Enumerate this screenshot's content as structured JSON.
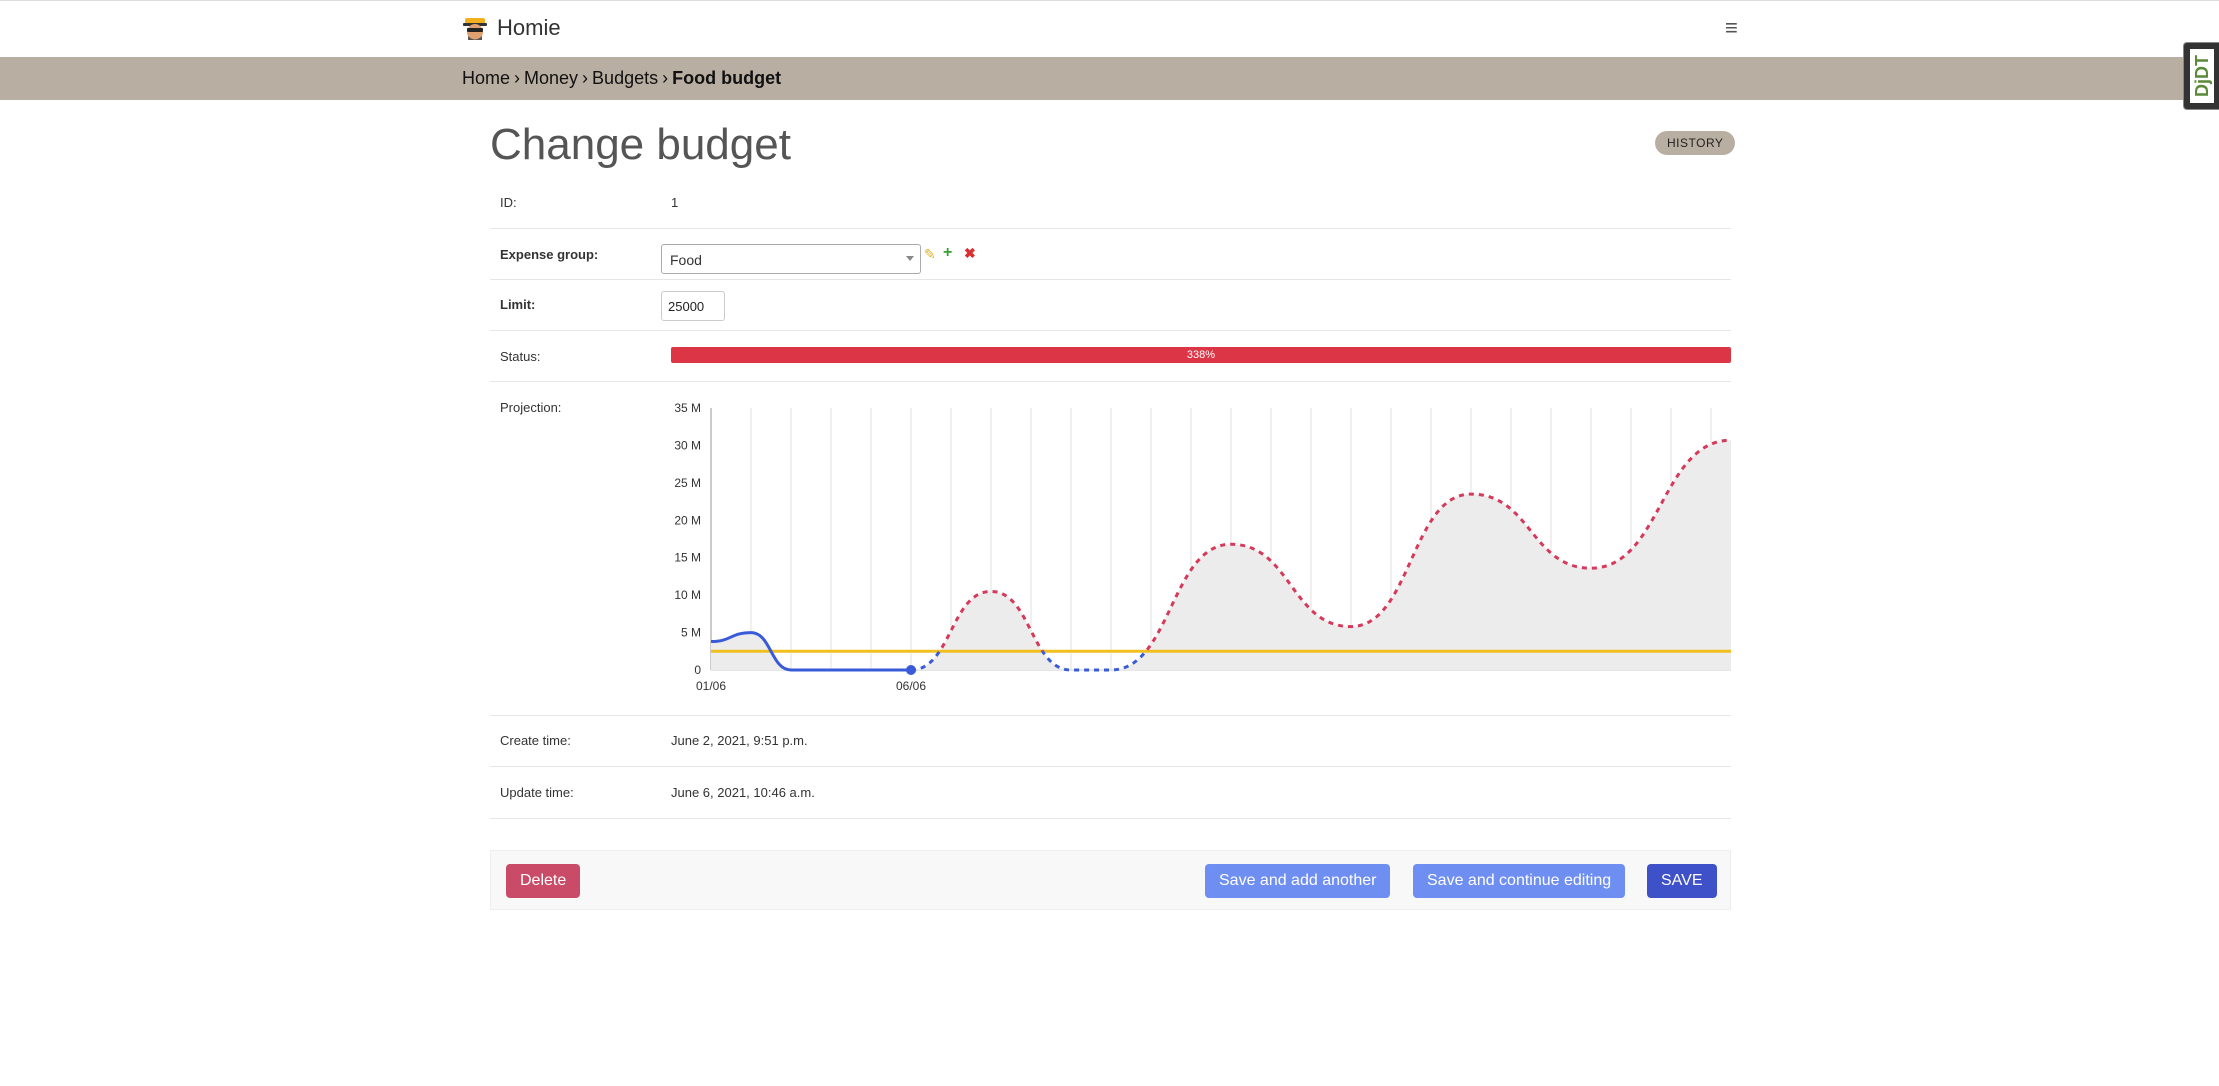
{
  "app": {
    "name": "Homie"
  },
  "breadcrumb": {
    "home": "Home",
    "money": "Money",
    "budgets": "Budgets",
    "current": "Food budget"
  },
  "toolbar": {
    "debug_label": "DjDT"
  },
  "page": {
    "title": "Change budget",
    "history_label": "HISTORY"
  },
  "form": {
    "id_label": "ID:",
    "id_value": "1",
    "expense_group_label": "Expense group:",
    "expense_group_value": "Food",
    "limit_label": "Limit:",
    "limit_value": "25000",
    "status_label": "Status:",
    "status_text": "338%",
    "status_fraction": 3.38,
    "projection_label": "Projection:",
    "create_label": "Create time:",
    "create_value": "June 2, 2021, 9:51 p.m.",
    "update_label": "Update time:",
    "update_value": "June 6, 2021, 10:46 a.m."
  },
  "actions": {
    "delete": "Delete",
    "save_add": "Save and add another",
    "save_continue": "Save and continue editing",
    "save": "SAVE"
  },
  "colors": {
    "actual": "#3a5bd9",
    "projected": "#d6395a",
    "limit": "#f0c020",
    "status": "#dc3545"
  },
  "chart_data": {
    "type": "line",
    "x_tick_labels": [
      "01/06",
      "06/06"
    ],
    "y_tick_labels": [
      "0",
      "5 M",
      "10 M",
      "15 M",
      "20 M",
      "25 M",
      "30 M",
      "35 M"
    ],
    "ylim": [
      0,
      35000000
    ],
    "xlim": [
      0,
      25.5
    ],
    "grid": true,
    "series": [
      {
        "style": "solid",
        "color": "#3a5bd9",
        "points": [
          [
            0,
            3800000
          ],
          [
            1,
            5000000
          ],
          [
            2,
            0
          ],
          [
            3,
            0
          ],
          [
            4,
            0
          ],
          [
            5,
            0
          ]
        ]
      },
      {
        "style": "dashed",
        "color": "#d6395a",
        "points": [
          [
            5,
            0
          ],
          [
            7,
            10500000
          ],
          [
            9,
            0
          ],
          [
            10,
            0
          ],
          [
            13,
            16800000
          ],
          [
            16,
            5800000
          ],
          [
            19,
            23500000
          ],
          [
            22,
            13600000
          ],
          [
            25.5,
            30700000
          ]
        ]
      },
      {
        "style": "solid",
        "color": "#f0c020",
        "points": [
          [
            0,
            2500000
          ],
          [
            25.5,
            2500000
          ]
        ]
      }
    ]
  }
}
